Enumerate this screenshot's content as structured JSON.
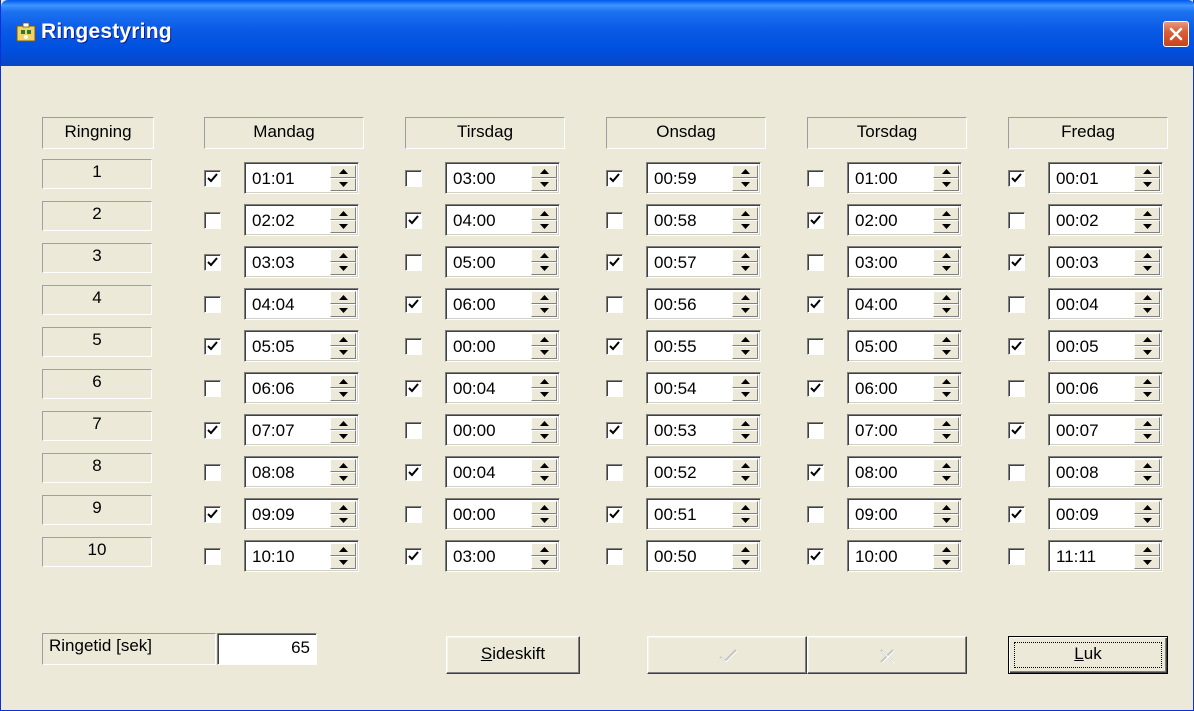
{
  "window": {
    "title": "Ringestyring",
    "close_icon": "close-icon",
    "app_icon": "app-icon"
  },
  "headers": {
    "ringning": "Ringning",
    "days": [
      "Mandag",
      "Tirsdag",
      "Onsdag",
      "Torsdag",
      "Fredag"
    ]
  },
  "rows": [
    {
      "num": "1",
      "cells": [
        {
          "checked": true,
          "time": "01:01"
        },
        {
          "checked": false,
          "time": "03:00"
        },
        {
          "checked": true,
          "time": "00:59"
        },
        {
          "checked": false,
          "time": "01:00"
        },
        {
          "checked": true,
          "time": "00:01"
        }
      ]
    },
    {
      "num": "2",
      "cells": [
        {
          "checked": false,
          "time": "02:02"
        },
        {
          "checked": true,
          "time": "04:00"
        },
        {
          "checked": false,
          "time": "00:58"
        },
        {
          "checked": true,
          "time": "02:00"
        },
        {
          "checked": false,
          "time": "00:02"
        }
      ]
    },
    {
      "num": "3",
      "cells": [
        {
          "checked": true,
          "time": "03:03"
        },
        {
          "checked": false,
          "time": "05:00"
        },
        {
          "checked": true,
          "time": "00:57"
        },
        {
          "checked": false,
          "time": "03:00"
        },
        {
          "checked": true,
          "time": "00:03"
        }
      ]
    },
    {
      "num": "4",
      "cells": [
        {
          "checked": false,
          "time": "04:04"
        },
        {
          "checked": true,
          "time": "06:00"
        },
        {
          "checked": false,
          "time": "00:56"
        },
        {
          "checked": true,
          "time": "04:00"
        },
        {
          "checked": false,
          "time": "00:04"
        }
      ]
    },
    {
      "num": "5",
      "cells": [
        {
          "checked": true,
          "time": "05:05"
        },
        {
          "checked": false,
          "time": "00:00"
        },
        {
          "checked": true,
          "time": "00:55"
        },
        {
          "checked": false,
          "time": "05:00"
        },
        {
          "checked": true,
          "time": "00:05"
        }
      ]
    },
    {
      "num": "6",
      "cells": [
        {
          "checked": false,
          "time": "06:06"
        },
        {
          "checked": true,
          "time": "00:04"
        },
        {
          "checked": false,
          "time": "00:54"
        },
        {
          "checked": true,
          "time": "06:00"
        },
        {
          "checked": false,
          "time": "00:06"
        }
      ]
    },
    {
      "num": "7",
      "cells": [
        {
          "checked": true,
          "time": "07:07"
        },
        {
          "checked": false,
          "time": "00:00"
        },
        {
          "checked": true,
          "time": "00:53"
        },
        {
          "checked": false,
          "time": "07:00"
        },
        {
          "checked": true,
          "time": "00:07"
        }
      ]
    },
    {
      "num": "8",
      "cells": [
        {
          "checked": false,
          "time": "08:08"
        },
        {
          "checked": true,
          "time": "00:04"
        },
        {
          "checked": false,
          "time": "00:52"
        },
        {
          "checked": true,
          "time": "08:00"
        },
        {
          "checked": false,
          "time": "00:08"
        }
      ]
    },
    {
      "num": "9",
      "cells": [
        {
          "checked": true,
          "time": "09:09"
        },
        {
          "checked": false,
          "time": "00:00"
        },
        {
          "checked": true,
          "time": "00:51"
        },
        {
          "checked": false,
          "time": "09:00"
        },
        {
          "checked": true,
          "time": "00:09"
        }
      ]
    },
    {
      "num": "10",
      "cells": [
        {
          "checked": false,
          "time": "10:10"
        },
        {
          "checked": true,
          "time": "03:00"
        },
        {
          "checked": false,
          "time": "00:50"
        },
        {
          "checked": true,
          "time": "10:00"
        },
        {
          "checked": false,
          "time": "11:11"
        }
      ]
    }
  ],
  "footer": {
    "ringetid_label": "Ringetid [sek]",
    "ringetid_value": "65",
    "sideskift_label": "Sideskift",
    "sideskift_hotkey": "S",
    "sideskift_rest": "ideskift",
    "ok_icon": "checkmark-icon",
    "cancel_icon": "x-icon",
    "luk_label": "Luk",
    "luk_hotkey": "L",
    "luk_rest": "uk"
  },
  "colors": {
    "titlebar": "#0a5ae6",
    "face": "#ece9d8",
    "close": "#d95f3a"
  }
}
